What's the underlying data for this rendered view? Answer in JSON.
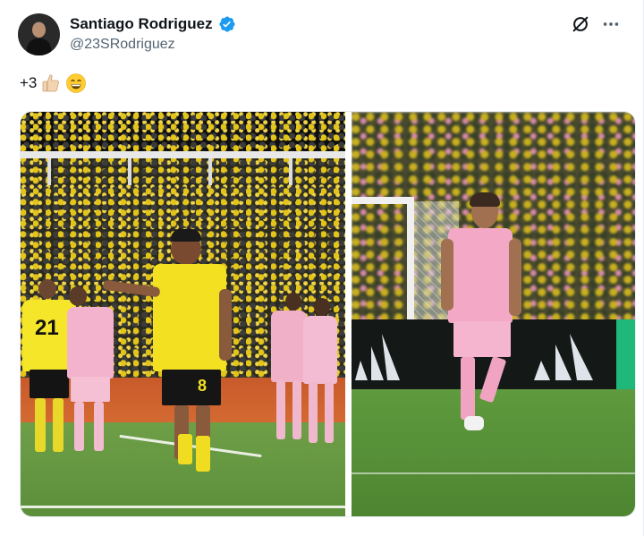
{
  "post": {
    "author": {
      "display_name": "Santiago Rodriguez",
      "handle": "@23SRodriguez",
      "verified_icon": "verified-badge-icon",
      "verified_color": "#1d9bf0"
    },
    "text": "+3",
    "emojis": [
      "thumbs-up-light-skin-tone",
      "grinning-face-with-smiling-eyes"
    ],
    "actions": {
      "grok_icon": "grok-icon",
      "more_icon": "more-options-icon"
    },
    "media": [
      {
        "kind": "photo",
        "description_icon": "photo-player-yellow-jersey",
        "jersey_numbers": [
          "21",
          "8"
        ]
      },
      {
        "kind": "photo",
        "description_icon": "photo-player-pink-jersey"
      }
    ]
  },
  "colors": {
    "text_primary": "#0f1419",
    "text_secondary": "#536471",
    "accent": "#1d9bf0"
  }
}
